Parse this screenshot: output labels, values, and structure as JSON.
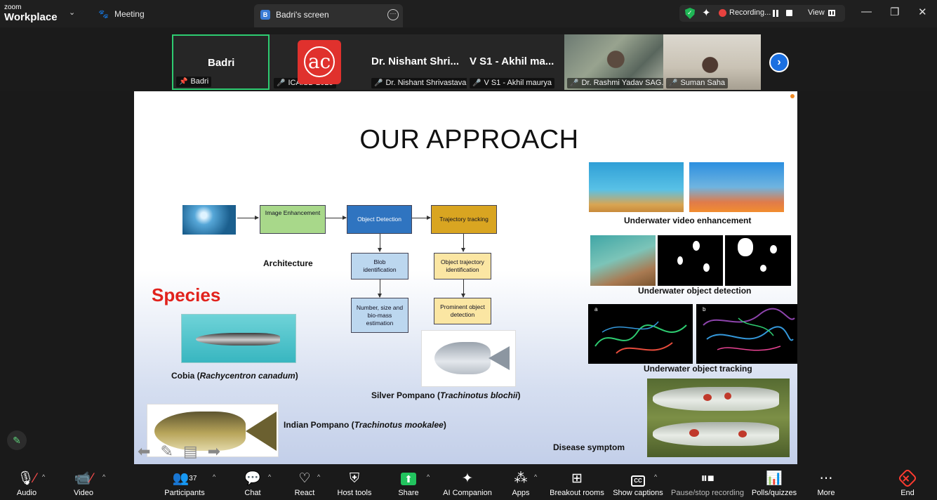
{
  "app": {
    "logo_small": "zoom",
    "logo_big": "Workplace"
  },
  "topbar": {
    "meeting_label": "Meeting",
    "tab_label": "Badri's screen",
    "tab_badge": "B",
    "recording_label": "Recording...",
    "view_label": "View",
    "accent_green": "#1fb655",
    "recording_color": "#e8423f"
  },
  "participants": [
    {
      "display": "Badri",
      "label": "Badri",
      "pinned": true,
      "highlight": "#2ecc71"
    },
    {
      "display": "ac",
      "label": "ICAISD 2025",
      "muted": true
    },
    {
      "display": "Dr. Nishant Shri...",
      "label": "Dr. Nishant Shrivastava",
      "muted": true
    },
    {
      "display": "V S1 - Akhil ma...",
      "label": "V S1 - Akhil maurya",
      "muted": true
    },
    {
      "display": "",
      "label": "Dr. Rashmi Yadav SAG...",
      "muted": true
    },
    {
      "display": "",
      "label": "Suman Saha",
      "muted": true
    }
  ],
  "slide": {
    "title": "OUR APPROACH",
    "flow": {
      "image_enhancement": "Image Enhancement",
      "object_detection": "Object Detection",
      "trajectory_tracking": "Trajectory tracking",
      "blob": "Blob identification",
      "number": "Number, size and bio-mass estimation",
      "object_trajectory": "Object trajectory identification",
      "prominent": "Prominent object detection",
      "architecture_label": "Architecture"
    },
    "species_label": "Species",
    "captions": {
      "cobia_name": "Cobia (",
      "cobia_sci": "Rachycentron canadum",
      "silver_name": "Silver Pompano (",
      "silver_sci": "Trachinotus blochii",
      "indian_name": "Indian Pompano (",
      "indian_sci": "Trachinotus mookalee",
      "close": ")",
      "enhancement": "Underwater video enhancement",
      "detection": "Underwater object detection",
      "tracking": "Underwater object tracking",
      "disease": "Disease symptom",
      "panel_a": "a",
      "panel_b": "b"
    },
    "species_color": "#e1221c",
    "flow_colors": {
      "enhancement": "#a8d88a",
      "detection": "#2f74c0",
      "tracking": "#d9a521",
      "blue_light": "#bcd7ef",
      "yellow_light": "#fbe6a3"
    }
  },
  "toolbar": {
    "audio": "Audio",
    "video": "Video",
    "participants": "Participants",
    "participants_count": "37",
    "chat": "Chat",
    "react": "React",
    "host_tools": "Host tools",
    "share": "Share",
    "ai_companion": "AI Companion",
    "apps": "Apps",
    "breakout_rooms": "Breakout rooms",
    "show_captions": "Show captions",
    "cc": "CC",
    "pause_stop": "Pause/stop recording",
    "polls": "Polls/quizzes",
    "more": "More",
    "end": "End",
    "end_color": "#ff3b30",
    "share_color": "#22c35e"
  }
}
